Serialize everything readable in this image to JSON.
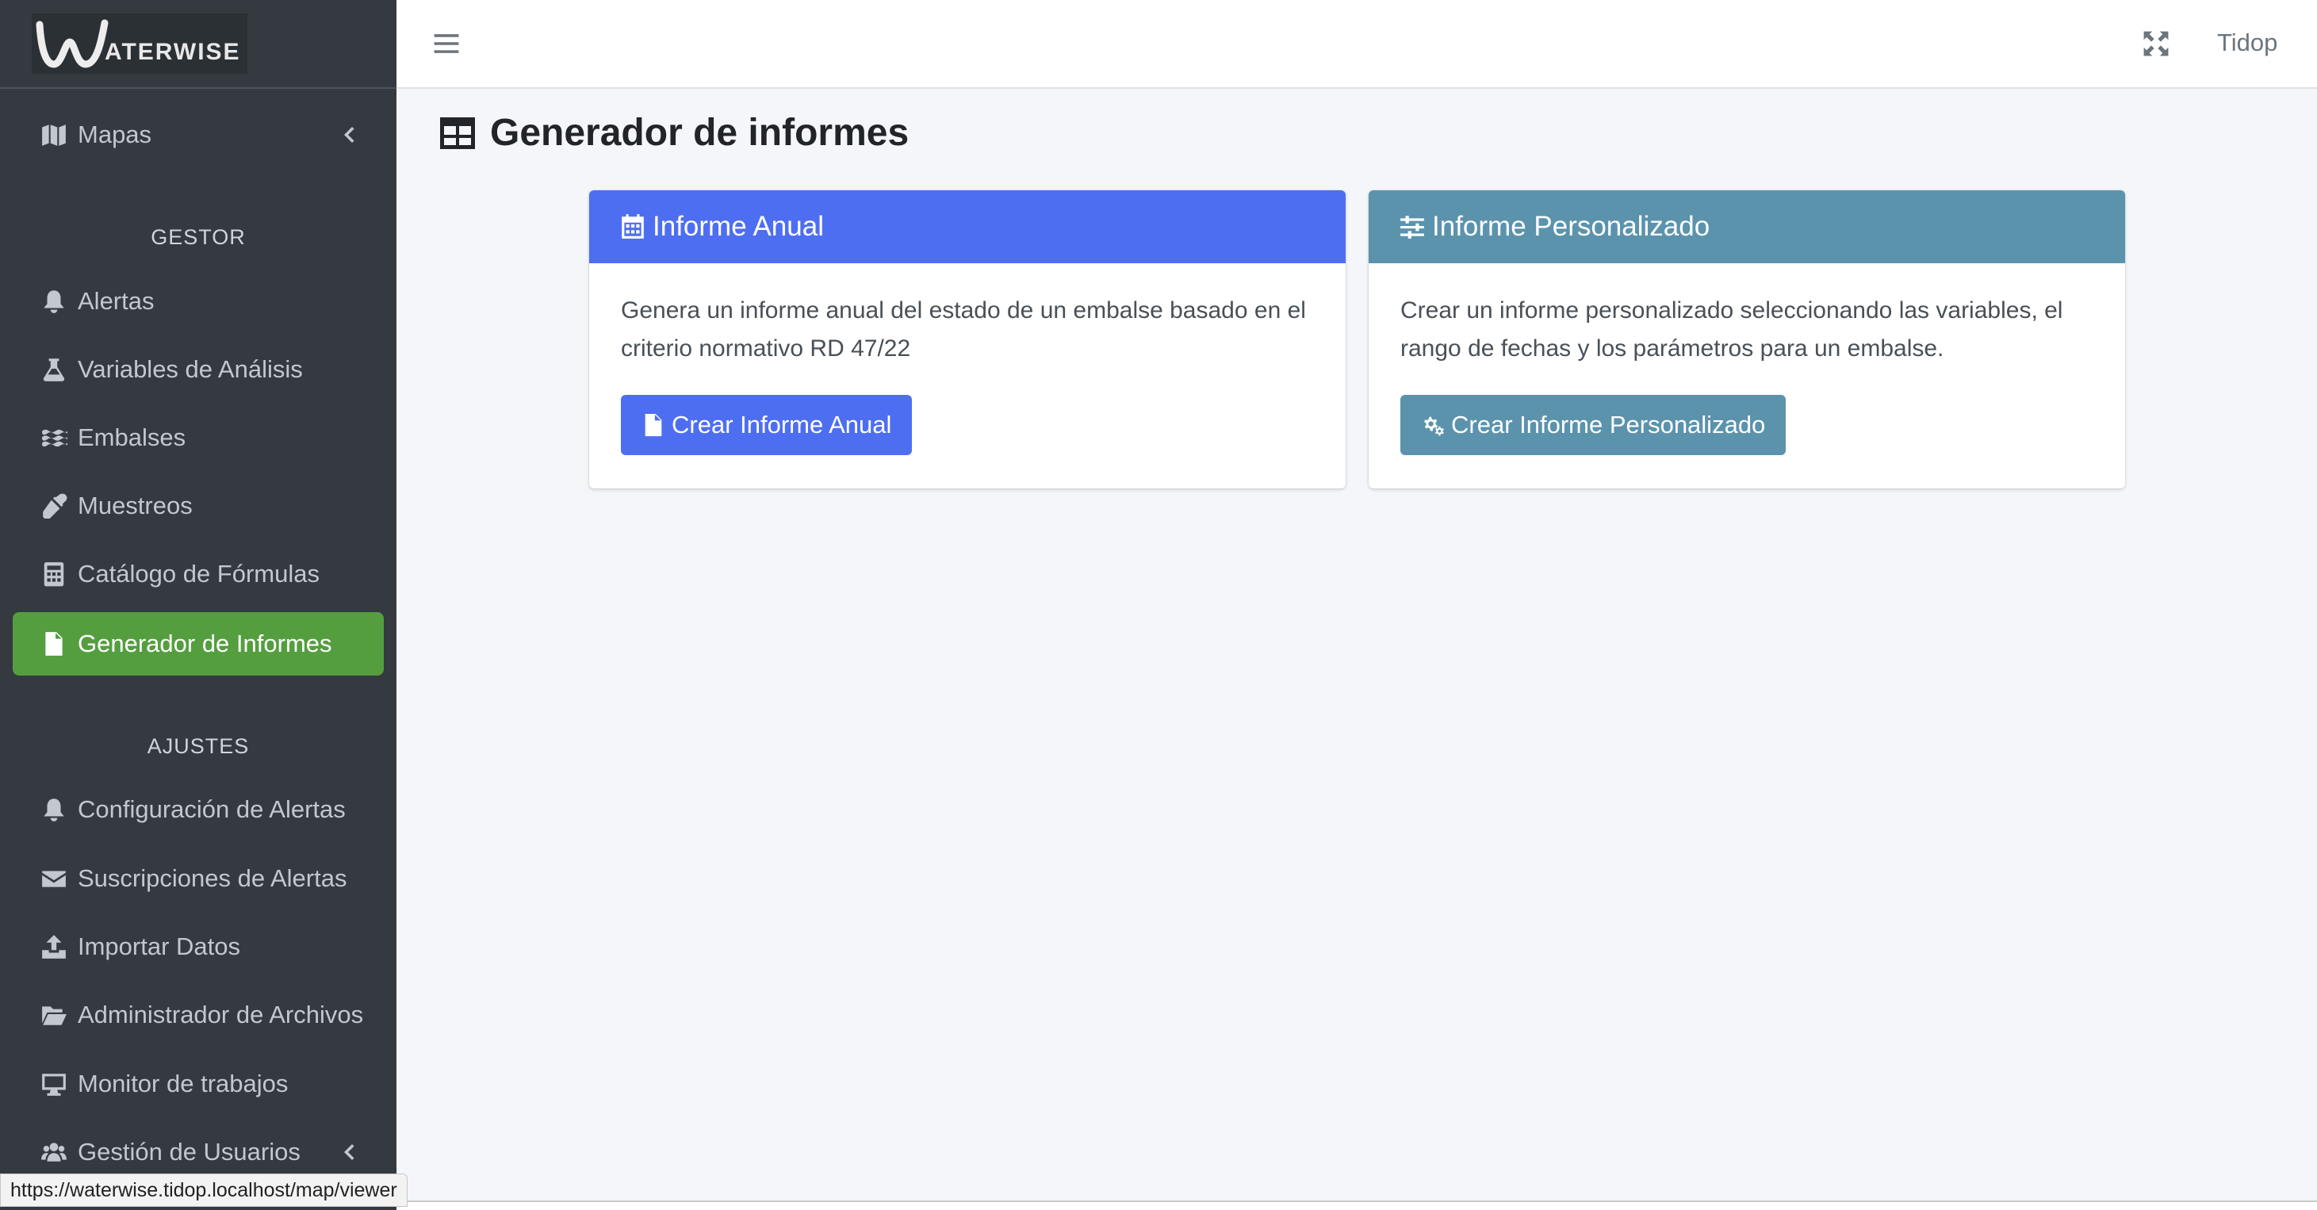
{
  "brand": {
    "logo_text": "ATERWISE"
  },
  "sidebar": {
    "top_item": {
      "label": "Mapas",
      "icon": "map-icon"
    },
    "sections": [
      {
        "header": "GESTOR",
        "items": [
          {
            "label": "Alertas",
            "icon": "bell-icon"
          },
          {
            "label": "Variables de Análisis",
            "icon": "flask-icon"
          },
          {
            "label": "Embalses",
            "icon": "water-icon"
          },
          {
            "label": "Muestreos",
            "icon": "eyedropper-icon"
          },
          {
            "label": "Catálogo de Fórmulas",
            "icon": "calculator-icon"
          },
          {
            "label": "Generador de Informes",
            "icon": "file-invoice-icon",
            "active": true
          }
        ]
      },
      {
        "header": "AJUSTES",
        "items": [
          {
            "label": "Configuración de Alertas",
            "icon": "bell-icon"
          },
          {
            "label": "Suscripciones de Alertas",
            "icon": "envelope-icon"
          },
          {
            "label": "Importar Datos",
            "icon": "upload-icon"
          },
          {
            "label": "Administrador de Archivos",
            "icon": "folder-open-icon"
          },
          {
            "label": "Monitor de trabajos",
            "icon": "desktop-icon"
          },
          {
            "label": "Gestión de Usuarios",
            "icon": "users-icon"
          }
        ]
      }
    ]
  },
  "topbar": {
    "user": "Tidop"
  },
  "page": {
    "title": "Generador de informes"
  },
  "cards": [
    {
      "title": "Informe Anual",
      "description": "Genera un informe anual del estado de un embalse basado en el criterio normativo RD 47/22",
      "button": "Crear Informe Anual",
      "header_color": "#4e6ef2",
      "button_color": "#4e6ef2"
    },
    {
      "title": "Informe Personalizado",
      "description": "Crear un informe personalizado seleccionando las variables, el rango de fechas y los parámetros para un embalse.",
      "button": "Crear Informe Personalizado",
      "header_color": "#5b93ad",
      "button_color": "#5b93ad"
    }
  ],
  "statusbar": {
    "url": "https://waterwise.tidop.localhost/map/viewer"
  },
  "colors": {
    "sidebar_bg": "#343a40",
    "active_item": "#549e3f",
    "content_bg": "#f4f6f9"
  }
}
